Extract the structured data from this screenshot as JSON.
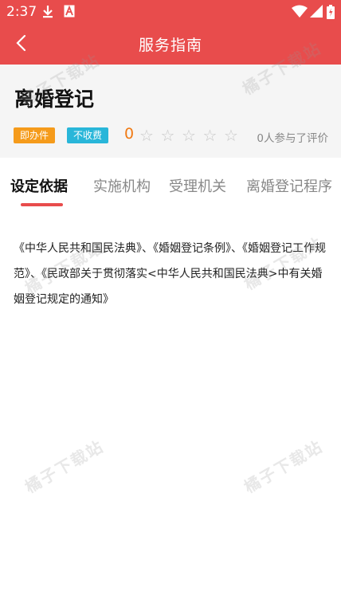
{
  "status_bar": {
    "time": "2:37"
  },
  "app_bar": {
    "title": "服务指南"
  },
  "item": {
    "title": "离婚登记",
    "badges": [
      "即办件",
      "不收费"
    ],
    "score": "0",
    "rating_text": "0人参与了评价",
    "rating": {
      "value": 0,
      "max": 5
    }
  },
  "tabs": [
    "设定依据",
    "实施机构",
    "受理机关",
    "离婚登记程序"
  ],
  "active_tab": "设定依据",
  "content": {
    "text": "《中华人民共和国民法典》、《婚姻登记条例》、《婚姻登记工作规范》、《民政部关于贯彻落实<中华人民共和国民法典>中有关婚姻登记规定的通知》"
  },
  "watermark": "橘子下载站",
  "colors": {
    "primary": "#e84c4c",
    "badge_orange": "#f59b1b",
    "badge_blue": "#29b6d9",
    "score": "#f07a14"
  },
  "icons": [
    "download-icon",
    "font-icon",
    "wifi-icon",
    "signal-icon",
    "battery-icon",
    "back-arrow-icon",
    "star-icon"
  ]
}
